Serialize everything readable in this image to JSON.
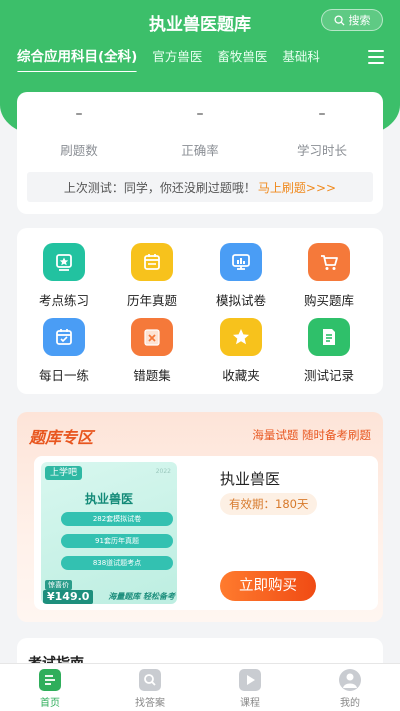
{
  "header": {
    "title": "执业兽医题库",
    "search_label": "搜索",
    "tabs": [
      {
        "label": "综合应用科目(全科)"
      },
      {
        "label": "官方兽医"
      },
      {
        "label": "畜牧兽医"
      },
      {
        "label": "基础科"
      }
    ]
  },
  "stats": {
    "items": [
      {
        "value": "–",
        "label": "刷题数"
      },
      {
        "value": "–",
        "label": "正确率"
      },
      {
        "value": "–",
        "label": "学习时长"
      }
    ],
    "last_test_text": "上次测试：同学，你还没刷过题哦！",
    "last_test_cta": "马上刷题>>>"
  },
  "features": [
    {
      "label": "考点练习",
      "icon": "badge-icon",
      "color": "#22c2a0"
    },
    {
      "label": "历年真题",
      "icon": "calendar-icon",
      "color": "#f7c21c"
    },
    {
      "label": "模拟试卷",
      "icon": "monitor-icon",
      "color": "#4a9df5"
    },
    {
      "label": "购买题库",
      "icon": "cart-icon",
      "color": "#f5793a"
    },
    {
      "label": "每日一练",
      "icon": "calendar-check-icon",
      "color": "#4a9df5"
    },
    {
      "label": "错题集",
      "icon": "wrong-book-icon",
      "color": "#f5793a"
    },
    {
      "label": "收藏夹",
      "icon": "star-icon",
      "color": "#f7c21c"
    },
    {
      "label": "测试记录",
      "icon": "document-icon",
      "color": "#2fc06a"
    }
  ],
  "zone": {
    "title": "题库专区",
    "slogan": "海量试题 随时备考刷题",
    "product": {
      "name": "执业兽医",
      "validity": "有效期：180天",
      "buy_label": "立即购买",
      "cover": {
        "brand": "上学吧",
        "small_text": "2022",
        "title": "执业兽医",
        "lines": [
          "282套模拟试卷",
          "91套历年真题",
          "838道试题考点"
        ],
        "price_tag": "惊喜价",
        "price": "¥149.0",
        "footer": "海量题库 轻松备考"
      }
    }
  },
  "guide": {
    "title": "考试指南"
  },
  "bottom_nav": [
    {
      "label": "首页",
      "icon": "home-icon",
      "active": true
    },
    {
      "label": "找答案",
      "icon": "find-answer-icon",
      "active": false
    },
    {
      "label": "课程",
      "icon": "course-icon",
      "active": false
    },
    {
      "label": "我的",
      "icon": "profile-icon",
      "active": false
    }
  ],
  "colors": {
    "brand_green": "#3cbf6a",
    "accent_orange": "#f04b14"
  }
}
